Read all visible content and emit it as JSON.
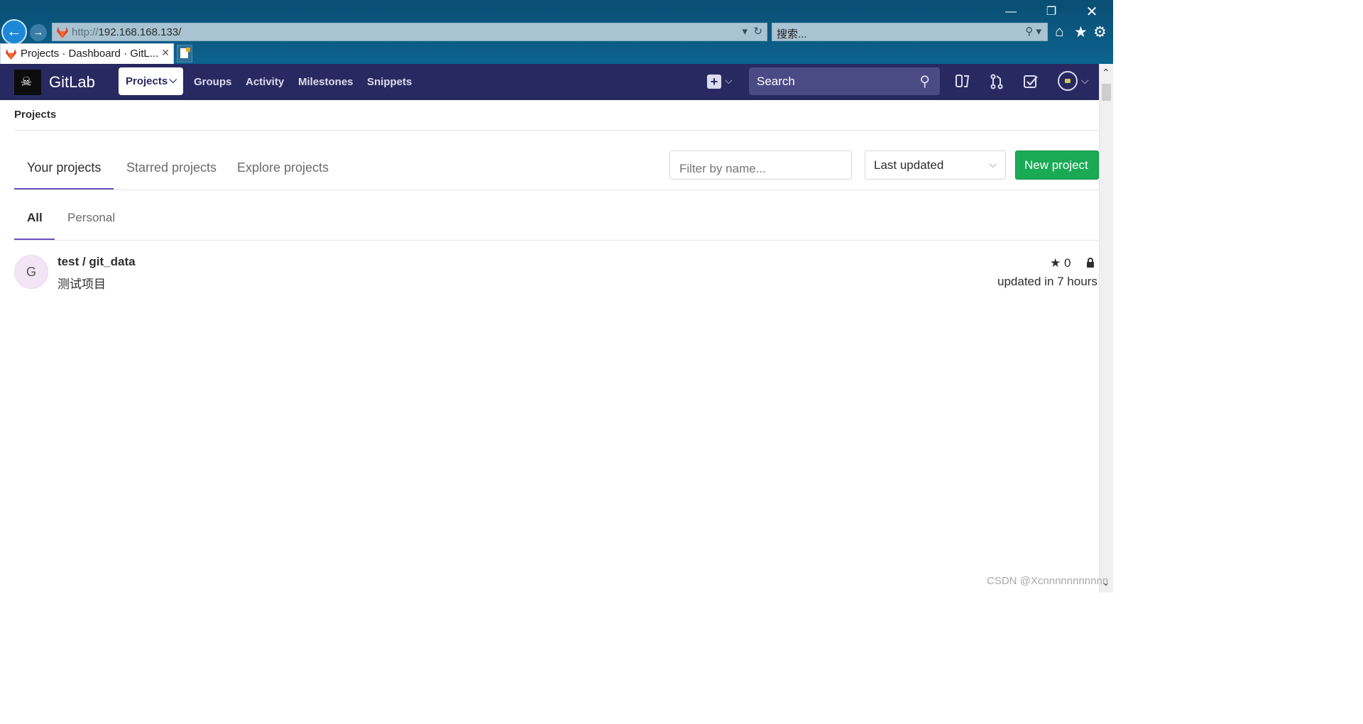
{
  "browser": {
    "url_protocol": "http://",
    "url_host": "192.168.168.133/",
    "search_placeholder": "搜索...",
    "tab_title": "Projects · Dashboard · GitL...",
    "window_controls": [
      "minimize-icon",
      "restore-icon",
      "close-icon"
    ]
  },
  "header": {
    "brand": "GitLab",
    "nav": {
      "projects": "Projects",
      "groups": "Groups",
      "activity": "Activity",
      "milestones": "Milestones",
      "snippets": "Snippets"
    },
    "search_placeholder": "Search",
    "icons": [
      "plus-icon",
      "issues-icon",
      "merge-request-icon",
      "todo-icon",
      "user-avatar"
    ]
  },
  "page": {
    "breadcrumb": "Projects",
    "tabs": {
      "your_projects": "Your projects",
      "starred": "Starred projects",
      "explore": "Explore projects"
    },
    "filter_placeholder": "Filter by name...",
    "sort_selected": "Last updated",
    "new_project_label": "New project",
    "subtabs": {
      "all": "All",
      "personal": "Personal"
    }
  },
  "projects": [
    {
      "initial": "G",
      "namespace_and_name": "test / git_data",
      "description": "测试项目",
      "stars": "0",
      "updated": "updated in 7 hours",
      "visibility": "private"
    }
  ],
  "watermark": "CSDN @Xcnnnnnnnnnnn",
  "colors": {
    "header_bg": "#292961",
    "accent_underline": "#6b4fbb",
    "new_button": "#1aaa55"
  }
}
